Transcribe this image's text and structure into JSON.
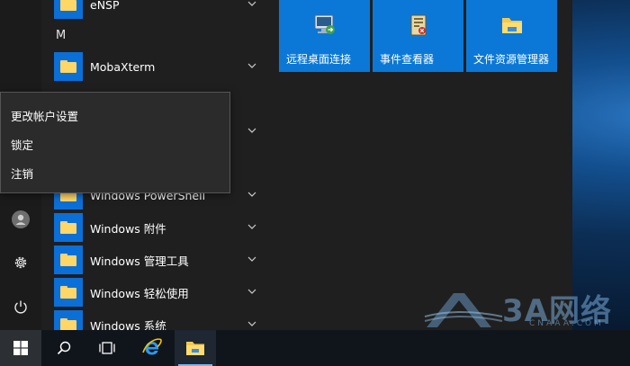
{
  "app_list": {
    "items": [
      {
        "label": "eNSP",
        "icon": "folder-icon"
      },
      {
        "label": "MobaXterm",
        "icon": "folder-icon"
      },
      {
        "label": "Windows PowerShell",
        "icon": "folder-icon"
      },
      {
        "label": "Windows 附件",
        "icon": "folder-icon"
      },
      {
        "label": "Windows 管理工具",
        "icon": "folder-icon"
      },
      {
        "label": "Windows 轻松使用",
        "icon": "folder-icon"
      },
      {
        "label": "Windows 系统",
        "icon": "folder-icon"
      }
    ],
    "section_m": "M"
  },
  "user_menu": {
    "items": [
      "更改帐户设置",
      "锁定",
      "注销"
    ]
  },
  "tiles": [
    {
      "label": "远程桌面连接",
      "icon": "remote-desktop-icon"
    },
    {
      "label": "事件查看器",
      "icon": "event-viewer-icon"
    },
    {
      "label": "文件资源管理器",
      "icon": "file-explorer-icon"
    }
  ],
  "watermark": {
    "brand": "3A网络",
    "sub": "CNAAA.COM"
  },
  "taskbar": {
    "items": [
      "start-icon",
      "search-icon",
      "task-view-icon",
      "internet-explorer-icon",
      "file-explorer-icon"
    ]
  },
  "colors": {
    "tile_blue": "#0b78d7",
    "menu_bg": "#1f1f1f",
    "taskbar_bg": "#10151c"
  }
}
